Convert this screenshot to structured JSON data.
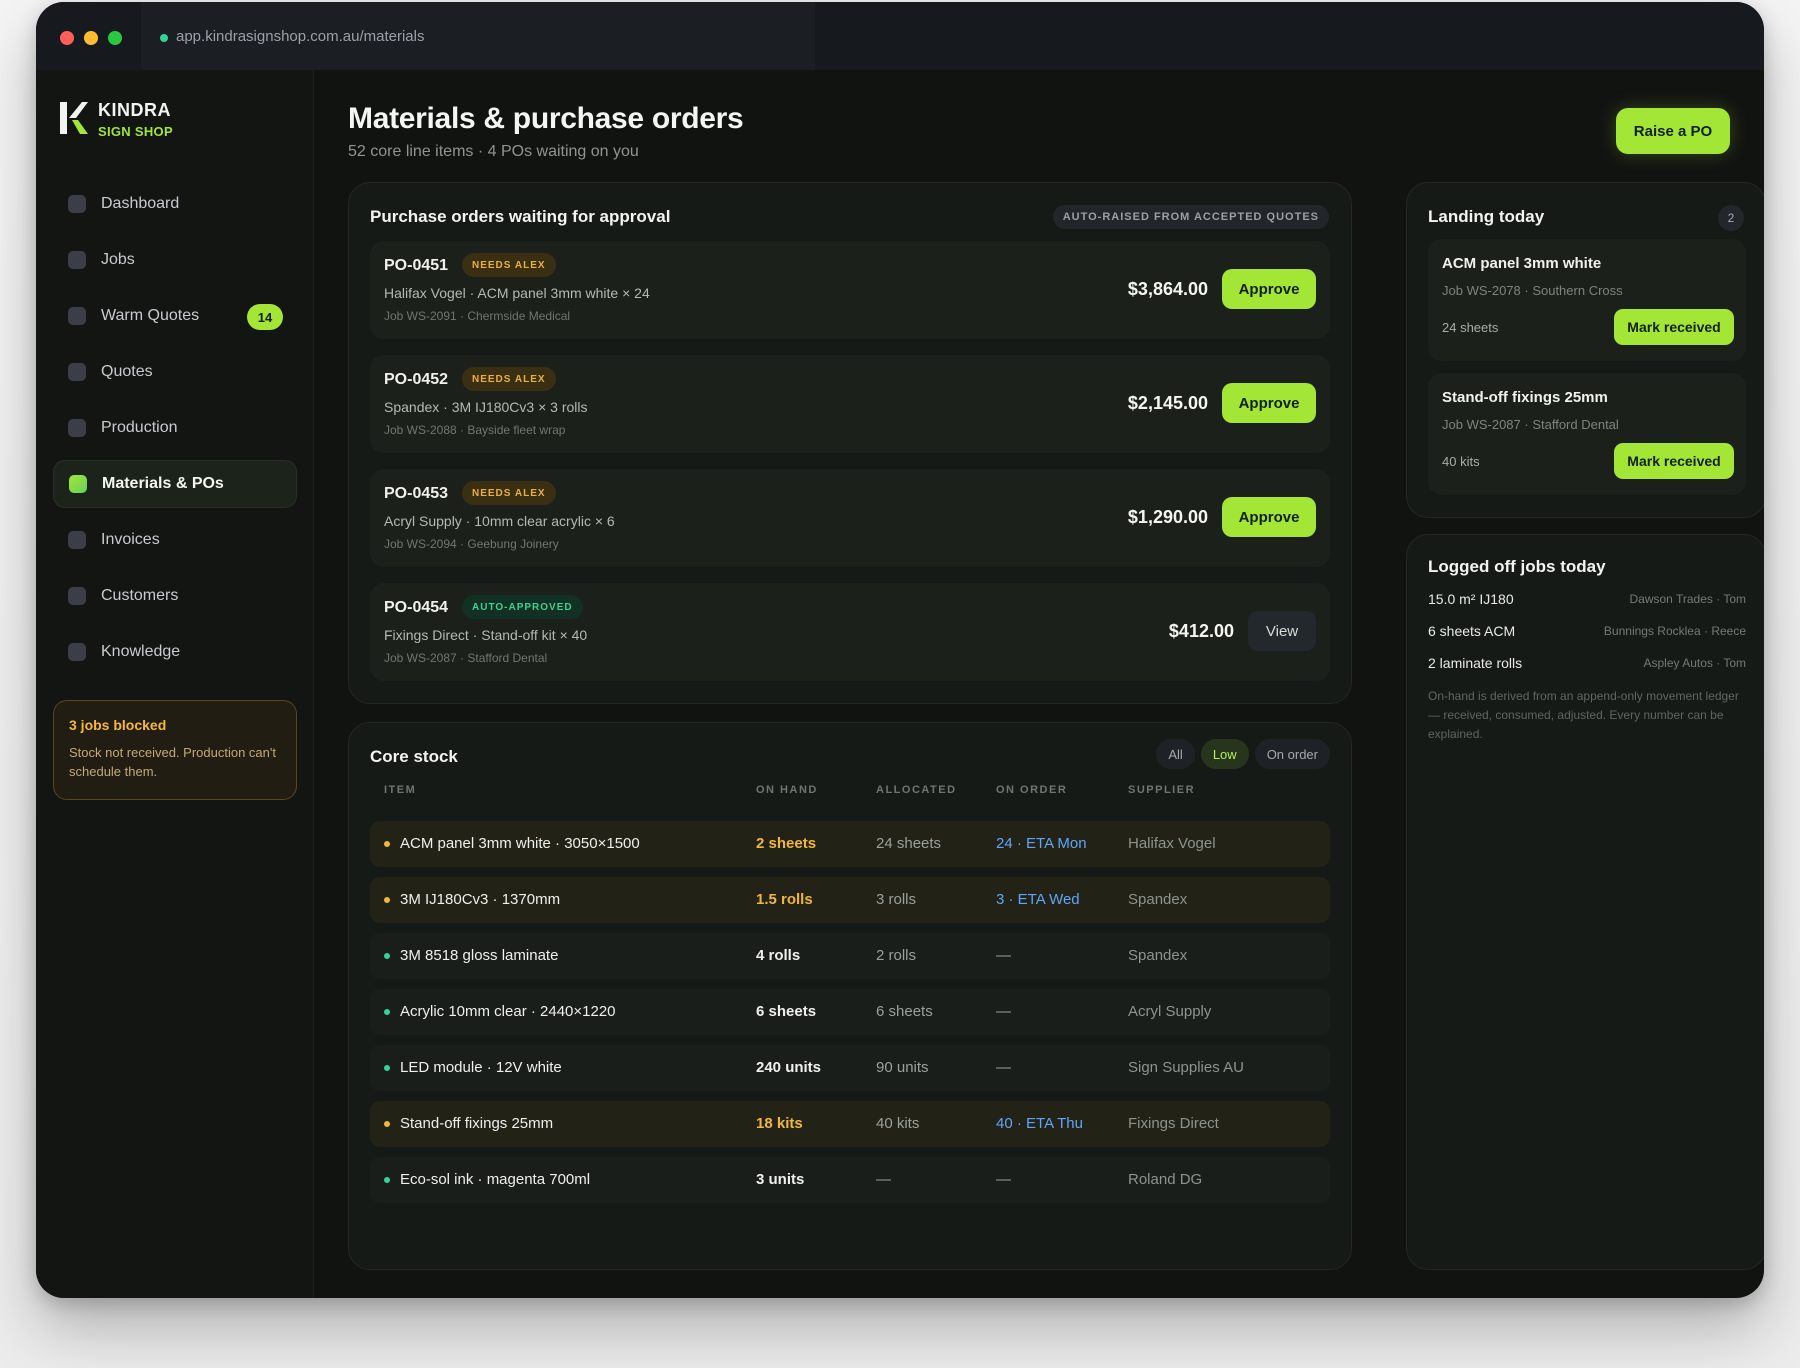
{
  "browser": {
    "url": "app.kindrasignshop.com.au/materials"
  },
  "brand": {
    "name": "KINDRA",
    "sub": "SIGN SHOP"
  },
  "sidebar": {
    "items": [
      {
        "label": "Dashboard",
        "active": false
      },
      {
        "label": "Jobs",
        "active": false
      },
      {
        "label": "Warm Quotes",
        "active": false,
        "badge": "14"
      },
      {
        "label": "Quotes",
        "active": false
      },
      {
        "label": "Production",
        "active": false
      },
      {
        "label": "Materials & POs",
        "active": true
      },
      {
        "label": "Invoices",
        "active": false
      },
      {
        "label": "Customers",
        "active": false
      },
      {
        "label": "Knowledge",
        "active": false
      }
    ],
    "blocked": {
      "title": "3 jobs blocked",
      "text": "Stock not received. Production can't schedule them."
    }
  },
  "header": {
    "title": "Materials & purchase orders",
    "subtitle": "52 core line items · 4 POs waiting on you",
    "raise_label": "Raise a PO"
  },
  "po_section": {
    "title": "Purchase orders waiting for approval",
    "tag": "AUTO-RAISED FROM ACCEPTED QUOTES",
    "rows": [
      {
        "id": "PO-0451",
        "status": "NEEDS ALEX",
        "line": "Halifax Vogel · ACM panel 3mm white × 24",
        "job": "Job WS-2091 · Chermside Medical",
        "amount": "$3,864.00",
        "action": "Approve"
      },
      {
        "id": "PO-0452",
        "status": "NEEDS ALEX",
        "line": "Spandex · 3M IJ180Cv3 × 3 rolls",
        "job": "Job WS-2088 · Bayside fleet wrap",
        "amount": "$2,145.00",
        "action": "Approve"
      },
      {
        "id": "PO-0453",
        "status": "NEEDS ALEX",
        "line": "Acryl Supply · 10mm clear acrylic × 6",
        "job": "Job WS-2094 · Geebung Joinery",
        "amount": "$1,290.00",
        "action": "Approve"
      },
      {
        "id": "PO-0454",
        "status": "AUTO-APPROVED",
        "line": "Fixings Direct · Stand-off kit × 40",
        "job": "Job WS-2087 · Stafford Dental",
        "amount": "$412.00",
        "action": "View"
      }
    ]
  },
  "stock": {
    "title": "Core stock",
    "filters": [
      {
        "label": "All",
        "active": false
      },
      {
        "label": "Low",
        "active": true
      },
      {
        "label": "On order",
        "active": false
      }
    ],
    "headers": {
      "item": "ITEM",
      "on_hand": "ON HAND",
      "allocated": "ALLOCATED",
      "on_order": "ON ORDER",
      "supplier": "SUPPLIER"
    },
    "rows": [
      {
        "item": "ACM panel 3mm white · 3050×1500",
        "on_hand": "2 sheets",
        "allocated": "24 sheets",
        "on_order": "24 · ETA Mon",
        "supplier": "Halifax Vogel",
        "low": true
      },
      {
        "item": "3M IJ180Cv3 · 1370mm",
        "on_hand": "1.5 rolls",
        "allocated": "3 rolls",
        "on_order": "3 · ETA Wed",
        "supplier": "Spandex",
        "low": true
      },
      {
        "item": "3M 8518 gloss laminate",
        "on_hand": "4 rolls",
        "allocated": "2 rolls",
        "on_order": "—",
        "supplier": "Spandex",
        "low": false
      },
      {
        "item": "Acrylic 10mm clear · 2440×1220",
        "on_hand": "6 sheets",
        "allocated": "6 sheets",
        "on_order": "—",
        "supplier": "Acryl Supply",
        "low": false
      },
      {
        "item": "LED module · 12V white",
        "on_hand": "240 units",
        "allocated": "90 units",
        "on_order": "—",
        "supplier": "Sign Supplies AU",
        "low": false
      },
      {
        "item": "Stand-off fixings 25mm",
        "on_hand": "18 kits",
        "allocated": "40 kits",
        "on_order": "40 · ETA Thu",
        "supplier": "Fixings Direct",
        "low": true
      },
      {
        "item": "Eco-sol ink · magenta 700ml",
        "on_hand": "3 units",
        "allocated": "—",
        "on_order": "—",
        "supplier": "Roland DG",
        "low": false
      }
    ]
  },
  "landing": {
    "title": "Landing today",
    "count": "2",
    "items": [
      {
        "name": "ACM panel 3mm white",
        "job": "Job WS-2078 · Southern Cross",
        "qty": "24 sheets",
        "action": "Mark received"
      },
      {
        "name": "Stand-off fixings 25mm",
        "job": "Job WS-2087 · Stafford Dental",
        "qty": "40 kits",
        "action": "Mark received"
      }
    ]
  },
  "logged": {
    "title": "Logged off jobs today",
    "rows": [
      {
        "qty": "15.0 m² IJ180",
        "source": "Dawson Trades · Tom"
      },
      {
        "qty": "6 sheets ACM",
        "source": "Bunnings Rocklea · Reece"
      },
      {
        "qty": "2 laminate rolls",
        "source": "Aspley Autos · Tom"
      }
    ],
    "note": "On-hand is derived from an append-only movement ledger — received, consumed, adjusted. Every number can be explained."
  },
  "colors": {
    "accent": "#a3e635",
    "warning": "#f2b63a",
    "info": "#60a5fa",
    "ok": "#34d399",
    "background": "#111311"
  }
}
